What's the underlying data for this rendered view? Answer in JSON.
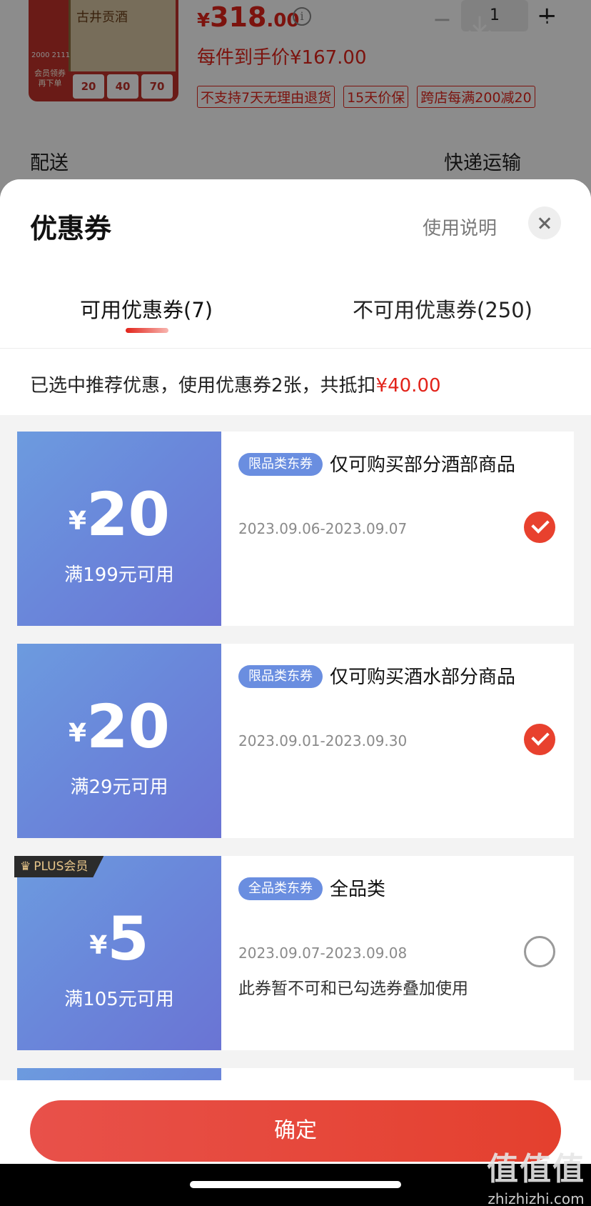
{
  "product": {
    "image_title": "古井贡酒",
    "image_vip": "会员领券 再下单",
    "image_strip": "2000 2111",
    "image_tiles": [
      "20",
      "40",
      "70"
    ],
    "price_currency": "¥",
    "price_int": "318",
    "price_dec": ".00",
    "info_icon": "i",
    "qty": "1",
    "qty_minus": "−",
    "qty_plus": "+",
    "unit_price": "每件到手价¥167.00",
    "tags": [
      "不支持7天无理由退货",
      "15天价保",
      "跨店每满200减20"
    ],
    "delivery_label": "配送",
    "delivery_value": "快递运输"
  },
  "sheet": {
    "title": "优惠券",
    "usage_link": "使用说明",
    "tabs": [
      {
        "label": "可用优惠券(7)",
        "active": true
      },
      {
        "label": "不可用优惠券(250)",
        "active": false
      }
    ],
    "summary_text": "已选中推荐优惠，使用优惠券2张，共抵扣",
    "summary_amount": "¥40.00"
  },
  "coupons": [
    {
      "yen": "¥",
      "amount": "20",
      "threshold": "满199元可用",
      "badge": "限品类东券",
      "title": "仅可购买部分酒部商品",
      "date": "2023.09.06-2023.09.07",
      "checked": true,
      "plus_badge": "",
      "note": ""
    },
    {
      "yen": "¥",
      "amount": "20",
      "threshold": "满29元可用",
      "badge": "限品类东券",
      "title": "仅可购买酒水部分商品",
      "date": "2023.09.01-2023.09.30",
      "checked": true,
      "plus_badge": "",
      "note": ""
    },
    {
      "yen": "¥",
      "amount": "5",
      "threshold": "满105元可用",
      "badge": "全品类东券",
      "title": "全品类",
      "date": "2023.09.07-2023.09.08",
      "checked": false,
      "plus_badge": "PLUS会员",
      "note": "此券暂不可和已勾选券叠加使用"
    }
  ],
  "footer": {
    "confirm_label": "确定"
  },
  "watermark": {
    "logo": "值值值",
    "url": "zhizhizhi.com"
  },
  "colors": {
    "accent": "#e2231a",
    "coupon_blue": "#6a86da",
    "check_red": "#e8412e"
  }
}
